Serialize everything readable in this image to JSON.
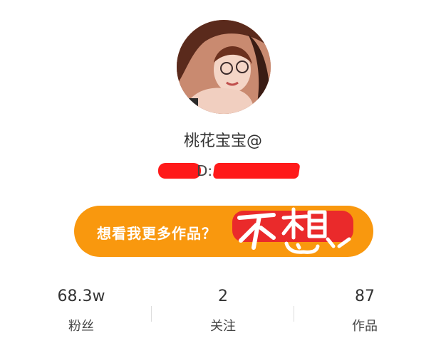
{
  "profile": {
    "username": "桃花宝宝@",
    "id_label": "D:",
    "cta_label": "想看我更多作品？",
    "cta_handwritten": "不想",
    "avatar_icon": "avatar-photo"
  },
  "stats": [
    {
      "value": "68.3w",
      "label": "粉丝"
    },
    {
      "value": "2",
      "label": "关注"
    },
    {
      "value": "87",
      "label": "作品"
    }
  ],
  "colors": {
    "accent": "#f9980e",
    "redaction": "#ff1a1a",
    "text": "#333333"
  }
}
